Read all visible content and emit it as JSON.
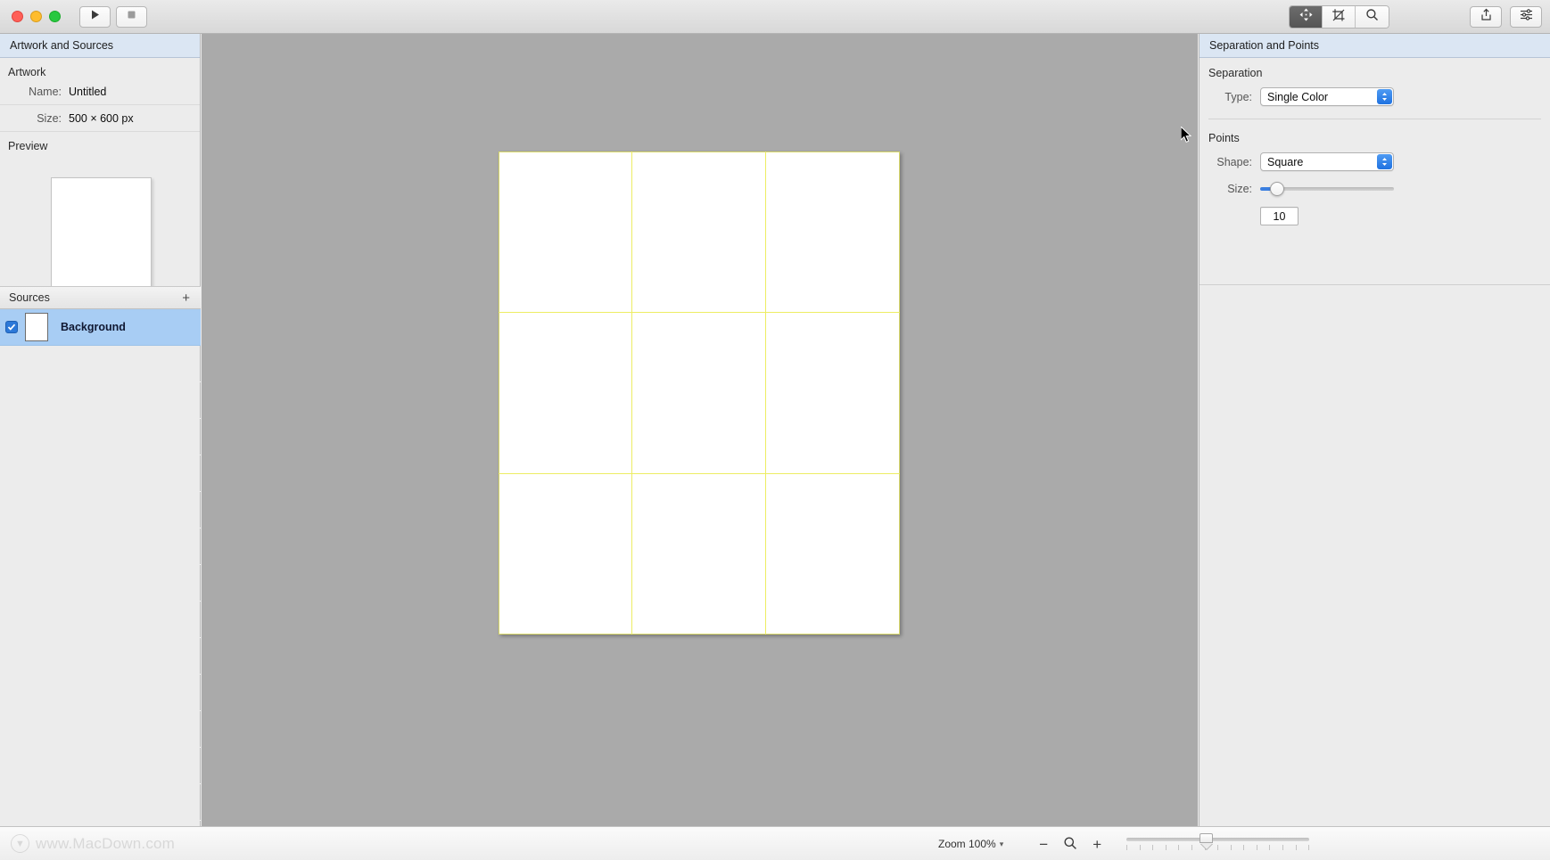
{
  "window": {
    "traffic_lights": [
      "close",
      "minimize",
      "maximize"
    ],
    "toolbar": {
      "play_label": "play-icon",
      "stop_label": "stop-icon",
      "move_tool": "move-icon",
      "crop_tool": "crop-icon",
      "zoom_tool": "magnifier-icon",
      "share": "share-icon",
      "adjust": "sliders-icon"
    }
  },
  "sidebar": {
    "header": "Artwork and Sources",
    "artwork_group": "Artwork",
    "fields": [
      {
        "label": "Name:",
        "value": "Untitled"
      },
      {
        "label": "Size:",
        "value": "500 × 600 px"
      }
    ],
    "preview_label": "Preview",
    "sources_title": "Sources",
    "add_button": "+",
    "sources": [
      {
        "name": "Background",
        "checked": true,
        "selected": true
      }
    ]
  },
  "canvas": {
    "background_color": "#aaaaaa",
    "artboard_color": "#ffffff",
    "guide_color": "#eded63",
    "guide_columns": 3,
    "guide_rows": 3
  },
  "right_panel": {
    "header": "Separation and Points",
    "separation": {
      "section_title": "Separation",
      "type_label": "Type:",
      "type_value": "Single Color",
      "type_options": [
        "Single Color"
      ]
    },
    "points": {
      "section_title": "Points",
      "shape_label": "Shape:",
      "shape_value": "Square",
      "shape_options": [
        "Square"
      ],
      "size_label": "Size:",
      "size_value": "10",
      "size_slider_percent": 9
    }
  },
  "bottom_bar": {
    "watermark": "www.MacDown.com",
    "zoom_label": "Zoom 100%",
    "zoom_caret": "▾",
    "zoom_out": "−",
    "zoom_in": "+",
    "zoom_reset_icon": "magnifier-icon",
    "zoom_slider_percent": 42,
    "tick_count": 15
  }
}
